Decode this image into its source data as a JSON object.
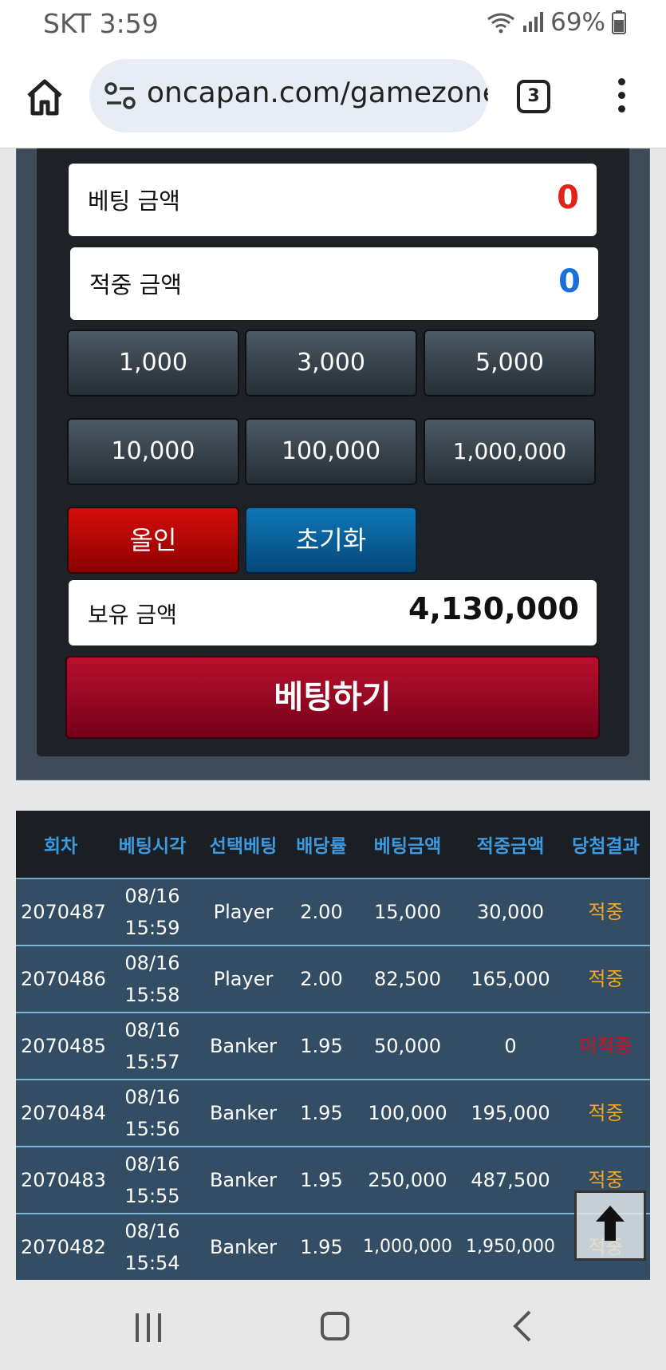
{
  "status_bar": {
    "carrier_time": "SKT 3:59",
    "battery": "69%"
  },
  "browser": {
    "url": "oncapan.com/gamezone",
    "tab_count": "3"
  },
  "bet_panel": {
    "bet_amount_label": "베팅 금액",
    "bet_amount_value": "0",
    "win_amount_label": "적중 금액",
    "win_amount_value": "0",
    "chips": [
      "1,000",
      "3,000",
      "5,000",
      "10,000",
      "100,000",
      "1,000,000"
    ],
    "allin_label": "올인",
    "reset_label": "초기화",
    "balance_label": "보유 금액",
    "balance_value": "4,130,000",
    "bet_button_label": "베팅하기"
  },
  "history": {
    "headers": [
      "회차",
      "베팅시각",
      "선택베팅",
      "배당률",
      "베팅금액",
      "적중금액",
      "당첨결과"
    ],
    "rows": [
      {
        "round": "2070487",
        "date": "08/16",
        "time": "15:59",
        "pick": "Player",
        "odds": "2.00",
        "bet": "15,000",
        "win": "30,000",
        "result": "적중"
      },
      {
        "round": "2070486",
        "date": "08/16",
        "time": "15:58",
        "pick": "Player",
        "odds": "2.00",
        "bet": "82,500",
        "win": "165,000",
        "result": "적중"
      },
      {
        "round": "2070485",
        "date": "08/16",
        "time": "15:57",
        "pick": "Banker",
        "odds": "1.95",
        "bet": "50,000",
        "win": "0",
        "result": "미적중"
      },
      {
        "round": "2070484",
        "date": "08/16",
        "time": "15:56",
        "pick": "Banker",
        "odds": "1.95",
        "bet": "100,000",
        "win": "195,000",
        "result": "적중"
      },
      {
        "round": "2070483",
        "date": "08/16",
        "time": "15:55",
        "pick": "Banker",
        "odds": "1.95",
        "bet": "250,000",
        "win": "487,500",
        "result": "적중"
      },
      {
        "round": "2070482",
        "date": "08/16",
        "time": "15:54",
        "pick": "Banker",
        "odds": "1.95",
        "bet": "1,000,000",
        "win": "1,950,000",
        "result": "적중"
      }
    ]
  },
  "colors": {
    "bet_amount": "#e2231a",
    "win_amount": "#1a6fd8",
    "result_hit": "#f5a623",
    "result_miss": "#d0121b",
    "header_text": "#3c9be0"
  }
}
